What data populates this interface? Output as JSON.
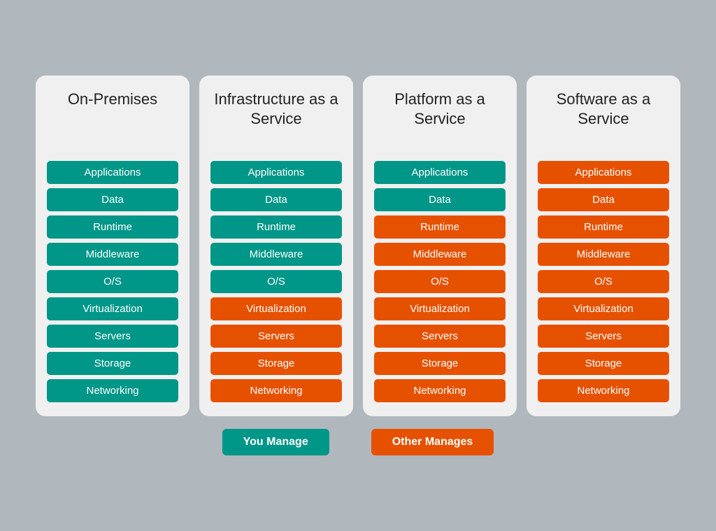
{
  "columns": [
    {
      "id": "on-premises",
      "title": "On-Premises",
      "items": [
        {
          "label": "Applications",
          "color": "teal"
        },
        {
          "label": "Data",
          "color": "teal"
        },
        {
          "label": "Runtime",
          "color": "teal"
        },
        {
          "label": "Middleware",
          "color": "teal"
        },
        {
          "label": "O/S",
          "color": "teal"
        },
        {
          "label": "Virtualization",
          "color": "teal"
        },
        {
          "label": "Servers",
          "color": "teal"
        },
        {
          "label": "Storage",
          "color": "teal"
        },
        {
          "label": "Networking",
          "color": "teal"
        }
      ]
    },
    {
      "id": "iaas",
      "title": "Infrastructure as a Service",
      "items": [
        {
          "label": "Applications",
          "color": "teal"
        },
        {
          "label": "Data",
          "color": "teal"
        },
        {
          "label": "Runtime",
          "color": "teal"
        },
        {
          "label": "Middleware",
          "color": "teal"
        },
        {
          "label": "O/S",
          "color": "teal"
        },
        {
          "label": "Virtualization",
          "color": "orange"
        },
        {
          "label": "Servers",
          "color": "orange"
        },
        {
          "label": "Storage",
          "color": "orange"
        },
        {
          "label": "Networking",
          "color": "orange"
        }
      ]
    },
    {
      "id": "paas",
      "title": "Platform as a Service",
      "items": [
        {
          "label": "Applications",
          "color": "teal"
        },
        {
          "label": "Data",
          "color": "teal"
        },
        {
          "label": "Runtime",
          "color": "orange"
        },
        {
          "label": "Middleware",
          "color": "orange"
        },
        {
          "label": "O/S",
          "color": "orange"
        },
        {
          "label": "Virtualization",
          "color": "orange"
        },
        {
          "label": "Servers",
          "color": "orange"
        },
        {
          "label": "Storage",
          "color": "orange"
        },
        {
          "label": "Networking",
          "color": "orange"
        }
      ]
    },
    {
      "id": "saas",
      "title": "Software as a Service",
      "items": [
        {
          "label": "Applications",
          "color": "orange"
        },
        {
          "label": "Data",
          "color": "orange"
        },
        {
          "label": "Runtime",
          "color": "orange"
        },
        {
          "label": "Middleware",
          "color": "orange"
        },
        {
          "label": "O/S",
          "color": "orange"
        },
        {
          "label": "Virtualization",
          "color": "orange"
        },
        {
          "label": "Servers",
          "color": "orange"
        },
        {
          "label": "Storage",
          "color": "orange"
        },
        {
          "label": "Networking",
          "color": "orange"
        }
      ]
    }
  ],
  "legend": {
    "you_manage": "You Manage",
    "other_manages": "Other Manages"
  }
}
